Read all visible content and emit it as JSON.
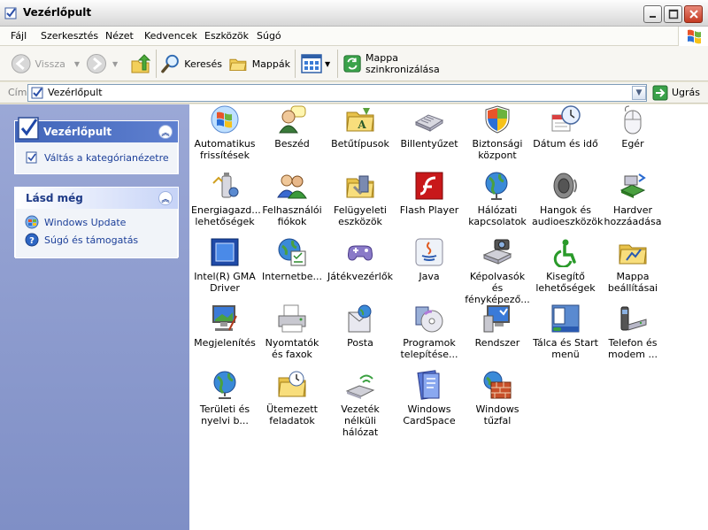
{
  "window": {
    "title": "Vezérlőpult"
  },
  "menu": [
    "Fájl",
    "Szerkesztés",
    "Nézet",
    "Kedvencek",
    "Eszközök",
    "Súgó"
  ],
  "toolbar": {
    "back": "Vissza",
    "search": "Keresés",
    "folders": "Mappák",
    "sync": "Mappa szinkronizálása"
  },
  "address": {
    "label": "Cím",
    "value": "Vezérlőpult",
    "go": "Ugrás"
  },
  "left": {
    "panel1": {
      "title": "Vezérlőpult",
      "tasks": [
        "Váltás a kategórianézetre"
      ]
    },
    "panel2": {
      "title": "Lásd még",
      "tasks": [
        "Windows Update",
        "Súgó és támogatás"
      ]
    }
  },
  "items": [
    "Automatikus frissítések",
    "Beszéd",
    "Betűtípusok",
    "Billentyűzet",
    "Biztonsági központ",
    "Dátum és idő",
    "Egér",
    "Energiagazd... lehetőségek",
    "Felhasználói fiókok",
    "Felügyeleti eszközök",
    "Flash Player",
    "Hálózati kapcsolatok",
    "Hangok és audioeszközök",
    "Hardver hozzáadása",
    "Intel(R) GMA Driver",
    "Internetbe...",
    "Játékvezérlők",
    "Java",
    "Képolvasók és fényképező...",
    "Kisegítő lehetőségek",
    "Mappa beállításai",
    "Megjelenítés",
    "Nyomtatók és faxok",
    "Posta",
    "Programok telepítése...",
    "Rendszer",
    "Tálca és Start menü",
    "Telefon és modem ...",
    "Területi és nyelvi b...",
    "Ütemezett feladatok",
    "Vezeték nélküli hálózat",
    "Windows CardSpace",
    "Windows tűzfal"
  ]
}
